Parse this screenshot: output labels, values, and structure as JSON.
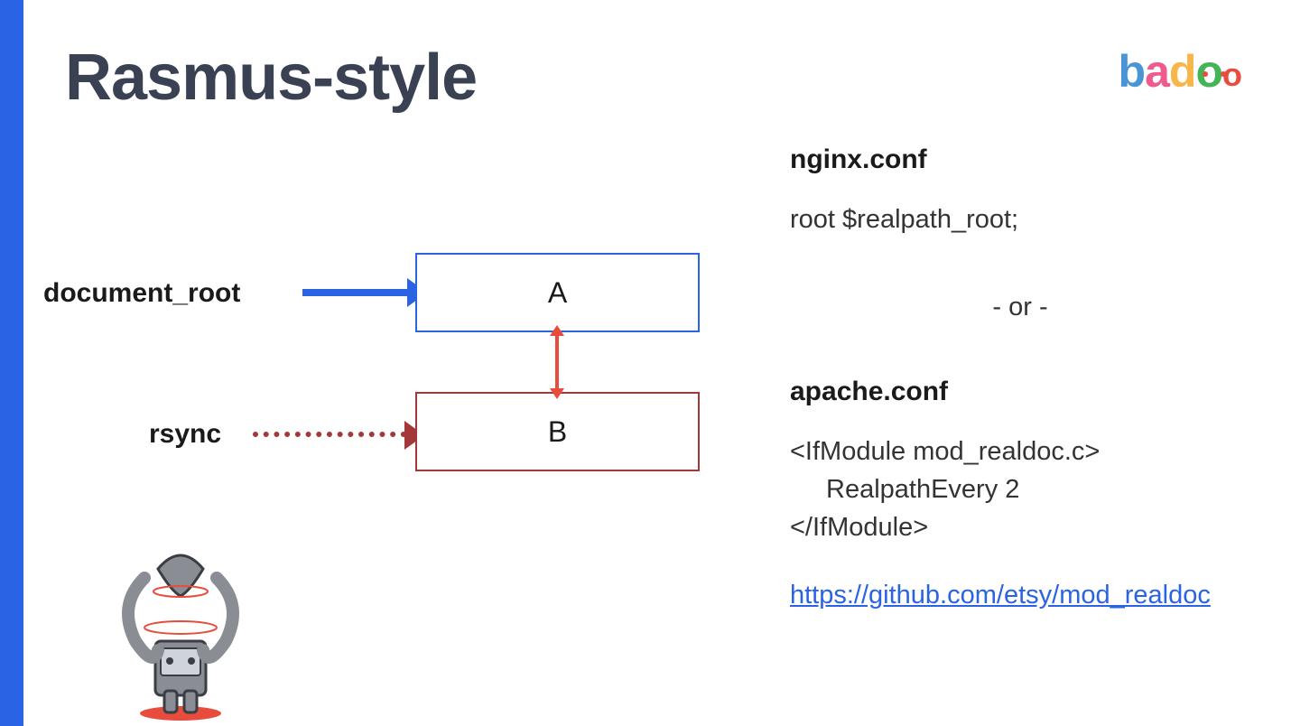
{
  "title": "Rasmus-style",
  "logo": {
    "b": "b",
    "a": "a",
    "d": "d",
    "o1": "o",
    "o2": "o"
  },
  "diagram": {
    "label_docroot": "document_root",
    "label_rsync": "rsync",
    "box_a": "A",
    "box_b": "B"
  },
  "config": {
    "nginx_title": "nginx.conf",
    "nginx_body": "root $realpath_root;",
    "or": "- or -",
    "apache_title": "apache.conf",
    "apache_line1": "<IfModule mod_realdoc.c>",
    "apache_line2": "RealpathEvery 2",
    "apache_line3": "</IfModule>",
    "link_text": "https://github.com/etsy/mod_realdoc",
    "link_href": "https://github.com/etsy/mod_realdoc"
  }
}
